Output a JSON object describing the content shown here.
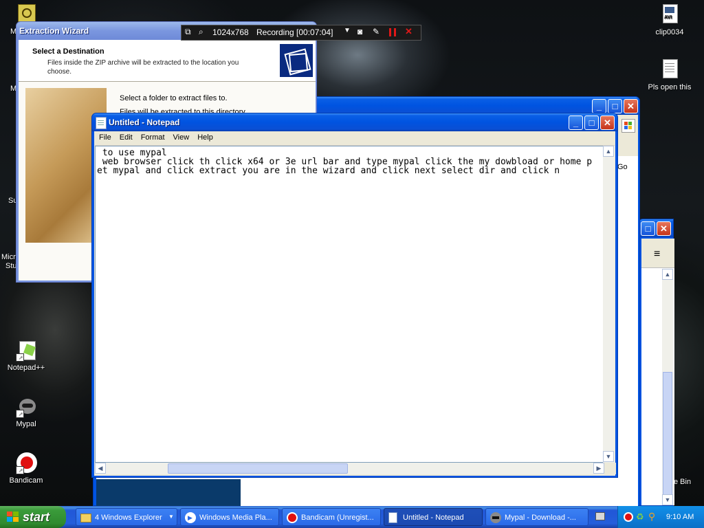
{
  "desktop": {
    "icons": [
      {
        "label": "clip0034"
      },
      {
        "label": "Pls open this"
      },
      {
        "label": "Notepad++"
      },
      {
        "label": "Mypal"
      },
      {
        "label": "Bandicam"
      }
    ],
    "partial_labels": [
      "M",
      "M",
      "Su",
      "Micro",
      "Stu",
      "r",
      "e Bin"
    ]
  },
  "recording_bar": {
    "resolution": "1024x768",
    "status": "Recording [00:07:04]"
  },
  "wizard": {
    "title": "Extraction Wizard",
    "heading": "Select a Destination",
    "subheading": "Files inside the ZIP archive will be extracted to the location you choose.",
    "instruction": "Select a folder to extract files to.",
    "instruction2": "Files will be extracted to this directory"
  },
  "browser": {
    "go_label": "Go",
    "menu_icon": "≡"
  },
  "notepad": {
    "title": "Untitled - Notepad",
    "menu": [
      "File",
      "Edit",
      "Format",
      "View",
      "Help"
    ],
    "content": " to use mypal\n web browser click th click x64 or 3e url bar and type mypal click the my dowbload or home p\net mypal and click extract you are in the wizard and click next select dir and click n"
  },
  "taskbar": {
    "start_label": "start",
    "tasks": [
      {
        "label": "4 Windows Explorer"
      },
      {
        "label": "Windows Media Pla..."
      },
      {
        "label": "Bandicam (Unregist..."
      },
      {
        "label": "Untitled - Notepad"
      },
      {
        "label": "Mypal - Download -..."
      }
    ],
    "clock": "9:10 AM"
  },
  "colors": {
    "xp_blue": "#0054e3",
    "start_green": "#3a9b3a",
    "tray_blue": "#0e80da"
  }
}
